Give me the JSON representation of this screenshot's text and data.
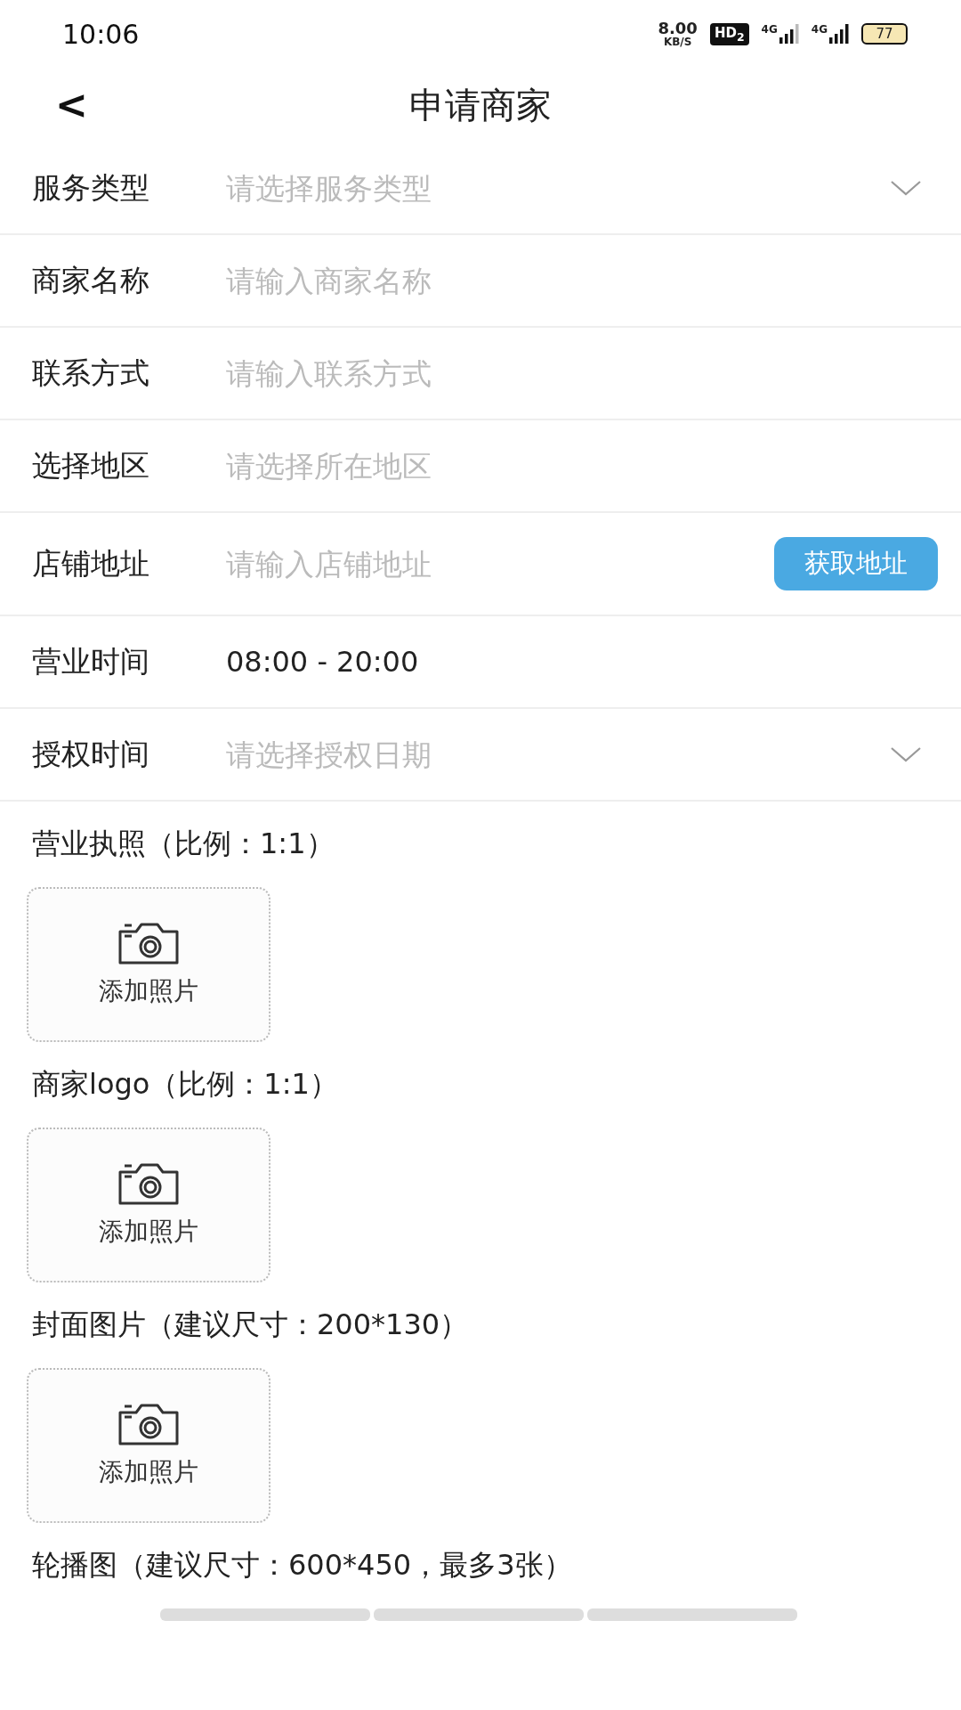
{
  "status_bar": {
    "time": "10:06",
    "speed_value": "8.00",
    "speed_unit": "KB/S",
    "hd_badge": "HD$_{2}$",
    "network_1": "4G",
    "network_2": "4G",
    "battery": "77"
  },
  "header": {
    "back": "<",
    "title": "申请商家"
  },
  "fields": [
    {
      "kind": "select",
      "label": "服务类型",
      "placeholder": "请选择服务类型"
    },
    {
      "kind": "input",
      "label": "商家名称",
      "placeholder": "请输入商家名称"
    },
    {
      "kind": "input",
      "label": "联系方式",
      "placeholder": "请输入联系方式"
    },
    {
      "kind": "input",
      "label": "选择地区",
      "placeholder": "请选择所在地区"
    },
    {
      "kind": "input_button",
      "label": "店铺地址",
      "placeholder": "请输入店铺地址",
      "button": "获取地址"
    },
    {
      "kind": "value",
      "label": "营业时间",
      "value": "08:00 - 20:00"
    },
    {
      "kind": "select",
      "label": "授权时间",
      "placeholder": "请选择授权日期"
    }
  ],
  "uploads": [
    {
      "title": "营业执照（比例：1:1）",
      "button": "添加照片"
    },
    {
      "title": "商家logo（比例：1:1）",
      "button": "添加照片"
    },
    {
      "title": "封面图片（建议尺寸：200*130）",
      "button": "添加照片"
    }
  ],
  "carousel": {
    "title": "轮播图（建议尺寸：600*450，最多3张）"
  }
}
